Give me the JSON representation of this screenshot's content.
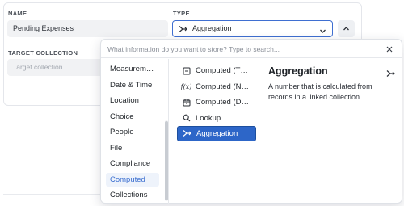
{
  "form": {
    "name_label": "NAME",
    "name_value": "Pending Expenses",
    "type_label": "TYPE",
    "type_value": "Aggregation",
    "target_label": "TARGET COLLECTION",
    "target_placeholder": "Target collection"
  },
  "picker": {
    "search_placeholder": "What information do you want to store? Type to search...",
    "categories": [
      {
        "label": "Measurem…",
        "selected": false
      },
      {
        "label": "Date & Time",
        "selected": false
      },
      {
        "label": "Location",
        "selected": false
      },
      {
        "label": "Choice",
        "selected": false
      },
      {
        "label": "People",
        "selected": false
      },
      {
        "label": "File",
        "selected": false
      },
      {
        "label": "Compliance",
        "selected": false
      },
      {
        "label": "Computed",
        "selected": true
      },
      {
        "label": "Collections",
        "selected": false
      }
    ],
    "options": [
      {
        "label": "Computed (T…",
        "icon": "text-box-icon",
        "selected": false
      },
      {
        "label": "Computed (N…",
        "icon": "function-icon",
        "selected": false
      },
      {
        "label": "Computed (D…",
        "icon": "calendar-icon",
        "selected": false
      },
      {
        "label": "Lookup",
        "icon": "search-icon",
        "selected": false
      },
      {
        "label": "Aggregation",
        "icon": "aggregation-icon",
        "selected": true
      }
    ],
    "detail": {
      "title": "Aggregation",
      "description": "A number that is calculated from records in a linked collection"
    }
  },
  "colors": {
    "accent": "#2d66c8",
    "selected_category_text": "#3b6fd0",
    "focus_border": "#3f6fd1"
  }
}
